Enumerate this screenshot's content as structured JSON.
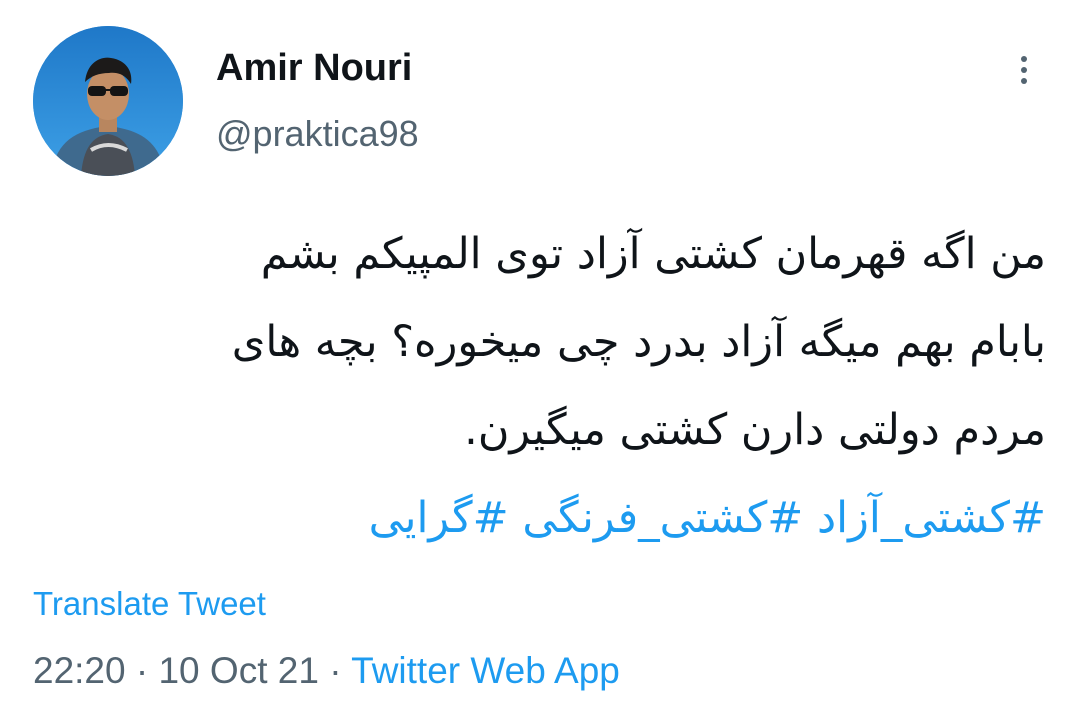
{
  "user": {
    "display_name": "Amir Nouri",
    "handle": "@praktica98"
  },
  "more_icon": "vertical-ellipsis-icon",
  "tweet": {
    "lines": [
      "من اگه قهرمان کشتی آزاد توی المپیکم بشم",
      "بابام بهم میگه آزاد بدرد چی میخوره؟ بچه های",
      "مردم دولتی دارن کشتی میگیرن."
    ],
    "hashtags": [
      "#کشتی_آزاد",
      "#کشتی_فرنگی",
      "#گرایی"
    ]
  },
  "translate_label": "Translate Tweet",
  "meta": {
    "time": "22:20",
    "separator": " · ",
    "date": "10 Oct 21",
    "source": "Twitter Web App"
  },
  "colors": {
    "accent": "#1d9bf0",
    "text": "#0f1419",
    "secondary": "#536471"
  }
}
